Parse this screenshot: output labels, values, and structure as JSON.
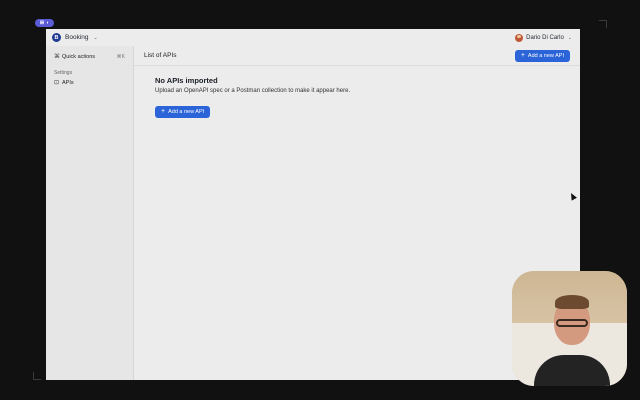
{
  "recording": {
    "badge": "⊞ ◖"
  },
  "workspace": {
    "logo_letter": "B",
    "name": "Booking"
  },
  "user": {
    "name": "Dario Di Carlo"
  },
  "sidebar": {
    "quick_actions": {
      "label": "Quick actions",
      "shortcut": "⌘K",
      "icon": "command-icon"
    },
    "section_label": "Settings",
    "items": [
      {
        "label": "APIs",
        "icon": "api-icon"
      }
    ]
  },
  "main": {
    "title": "List of APIs",
    "add_button": "Add a new API",
    "empty": {
      "title": "No APIs imported",
      "subtitle": "Upload an OpenAPI spec or a Postman collection to make it appear here.",
      "button": "Add a new API"
    }
  },
  "colors": {
    "accent": "#2b63d9",
    "workspace_logo": "#1f3a93"
  }
}
